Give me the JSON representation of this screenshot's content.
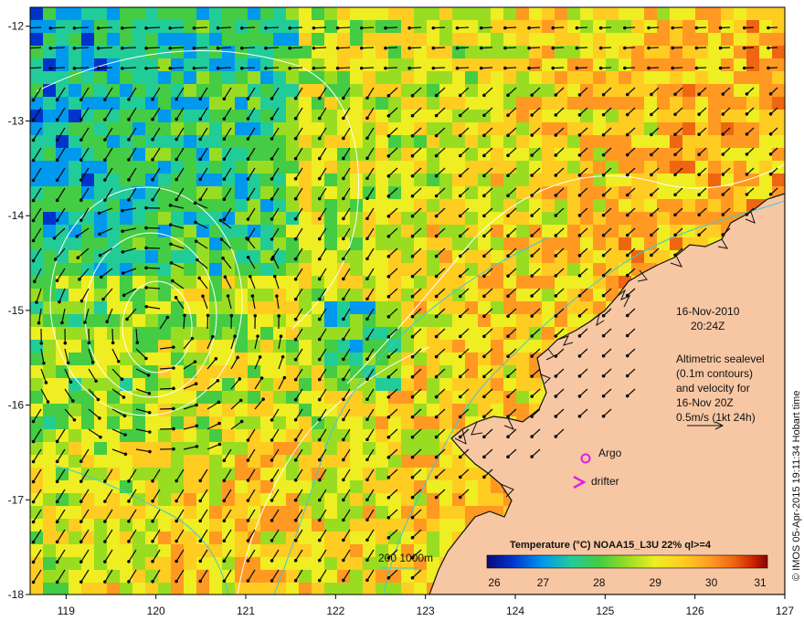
{
  "map": {
    "colors": {
      "land": "#f7c7a4",
      "coast": "#111111",
      "arrow": "#0a0a0a",
      "contour": "#ffffff",
      "depth_contour": "#3ec9d6",
      "argo": "#e020e0",
      "drifter": "#e020e0"
    },
    "axes": {
      "x_ticks": [
        "119",
        "120",
        "121",
        "122",
        "123",
        "124",
        "125",
        "126",
        "127"
      ],
      "y_ticks": [
        "-12",
        "-13",
        "-14",
        "-15",
        "-16",
        "-17",
        "-18"
      ],
      "lon_range": [
        118.6,
        127.0
      ],
      "lat_range": [
        -18.0,
        -11.8
      ]
    },
    "date": "16-Nov-2010",
    "time": "20:24Z",
    "info_lines": [
      "Altimetric sealevel",
      "(0.1m contours)",
      "and velocity for",
      "16-Nov 20Z",
      "0.5m/s (1kt 24h)"
    ],
    "argo_label": "Argo",
    "drifter_label": "drifter",
    "depth_label": "200  1000m",
    "colorbar": {
      "title": "Temperature (°C) NOAA15_L3U 22% ql>=4",
      "ticks": [
        "26",
        "27",
        "28",
        "29",
        "30",
        "31"
      ],
      "range": [
        26,
        31
      ],
      "colors": [
        "#0a0a7a",
        "#0033cc",
        "#0099ee",
        "#22cc99",
        "#44cc44",
        "#99dd22",
        "#eeee22",
        "#ffcc22",
        "#ff9922",
        "#ee6611",
        "#cc2200",
        "#880000"
      ]
    },
    "credit": "© IMOS 05-Apr-2015 19:11:34 Hobart time"
  }
}
